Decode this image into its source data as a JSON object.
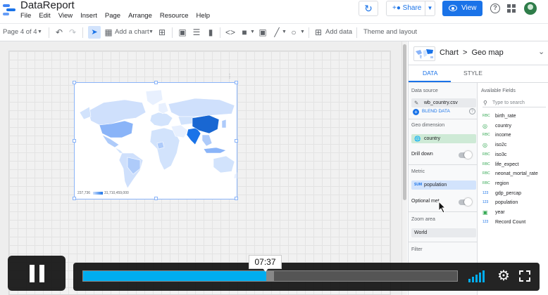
{
  "app": {
    "title": "DataReport",
    "menu": [
      "File",
      "Edit",
      "View",
      "Insert",
      "Page",
      "Arrange",
      "Resource",
      "Help"
    ]
  },
  "header": {
    "share_label": "Share",
    "view_label": "View"
  },
  "toolbar": {
    "page_indicator": "Page 4 of 4",
    "add_chart_label": "Add a chart",
    "add_data_label": "Add data",
    "theme_label": "Theme and layout"
  },
  "chart": {
    "legend_min": "237,736",
    "legend_max": "31,710,459,000",
    "colors": {
      "low": "#cfe0fc",
      "mid": "#8ab4f8",
      "high": "#1a73e8"
    }
  },
  "panel": {
    "breadcrumb_root": "Chart",
    "breadcrumb_sep": ">",
    "breadcrumb_leaf": "Geo map",
    "tabs": [
      "DATA",
      "STYLE"
    ],
    "active_tab": "DATA",
    "data_source_title": "Data source",
    "data_source_name": "wb_country.csv",
    "blend_label": "BLEND DATA",
    "geo_dimension_title": "Geo dimension",
    "geo_dimension_value": "country",
    "drill_down_label": "Drill down",
    "metric_title": "Metric",
    "metric_agg": "SUM",
    "metric_value": "population",
    "optional_metrics_label": "Optional met",
    "zoom_area_title": "Zoom area",
    "zoom_area_value": "World",
    "filter_title": "Filter",
    "available_fields_title": "Available Fields",
    "search_placeholder": "Type to search",
    "fields": [
      {
        "type": "ABC",
        "name": "birth_rate"
      },
      {
        "type": "geo",
        "name": "country"
      },
      {
        "type": "ABC",
        "name": "income"
      },
      {
        "type": "geo",
        "name": "iso2c"
      },
      {
        "type": "ABC",
        "name": "iso3c"
      },
      {
        "type": "ABC",
        "name": "life_expect"
      },
      {
        "type": "ABC",
        "name": "neonat_mortal_rate"
      },
      {
        "type": "ABC",
        "name": "region"
      },
      {
        "type": "123",
        "name": "gdp_percap"
      },
      {
        "type": "123",
        "name": "population"
      },
      {
        "type": "date",
        "name": "year"
      },
      {
        "type": "123",
        "name": "Record Count"
      }
    ]
  },
  "video": {
    "time_tooltip": "07:37",
    "progress": 0.49,
    "buffered": 0.5,
    "accent_color": "#00adef"
  }
}
